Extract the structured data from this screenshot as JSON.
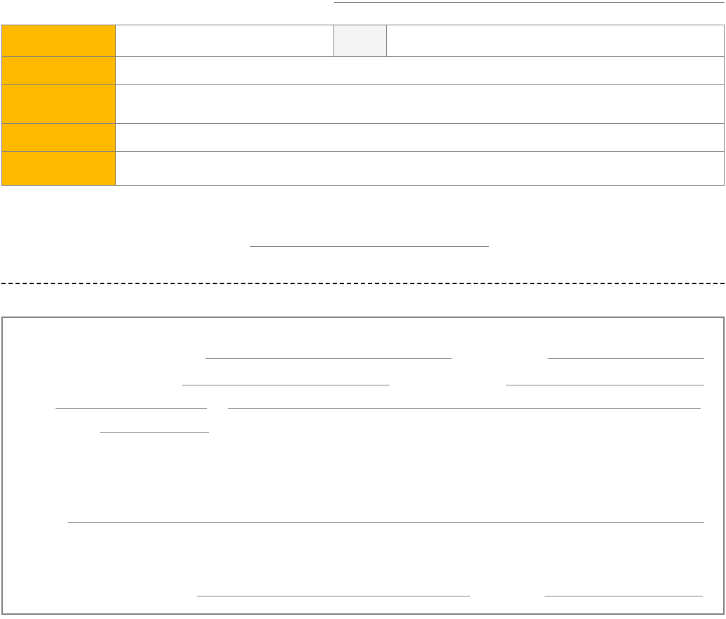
{
  "table": {
    "rows": [
      {
        "label": "",
        "value1": "",
        "value2": "",
        "value3": ""
      },
      {
        "label": "",
        "value": ""
      },
      {
        "label": "",
        "value": ""
      },
      {
        "label": "",
        "value": ""
      },
      {
        "label": "",
        "value": ""
      }
    ]
  },
  "topLine": "",
  "midLine": "",
  "form": {
    "line1_left": "",
    "line1_right": "",
    "line2_left": "",
    "line2_right": "",
    "line3_left": "",
    "line3_right": "",
    "line4": "",
    "line5": "",
    "line6_left": "",
    "line6_right": ""
  }
}
